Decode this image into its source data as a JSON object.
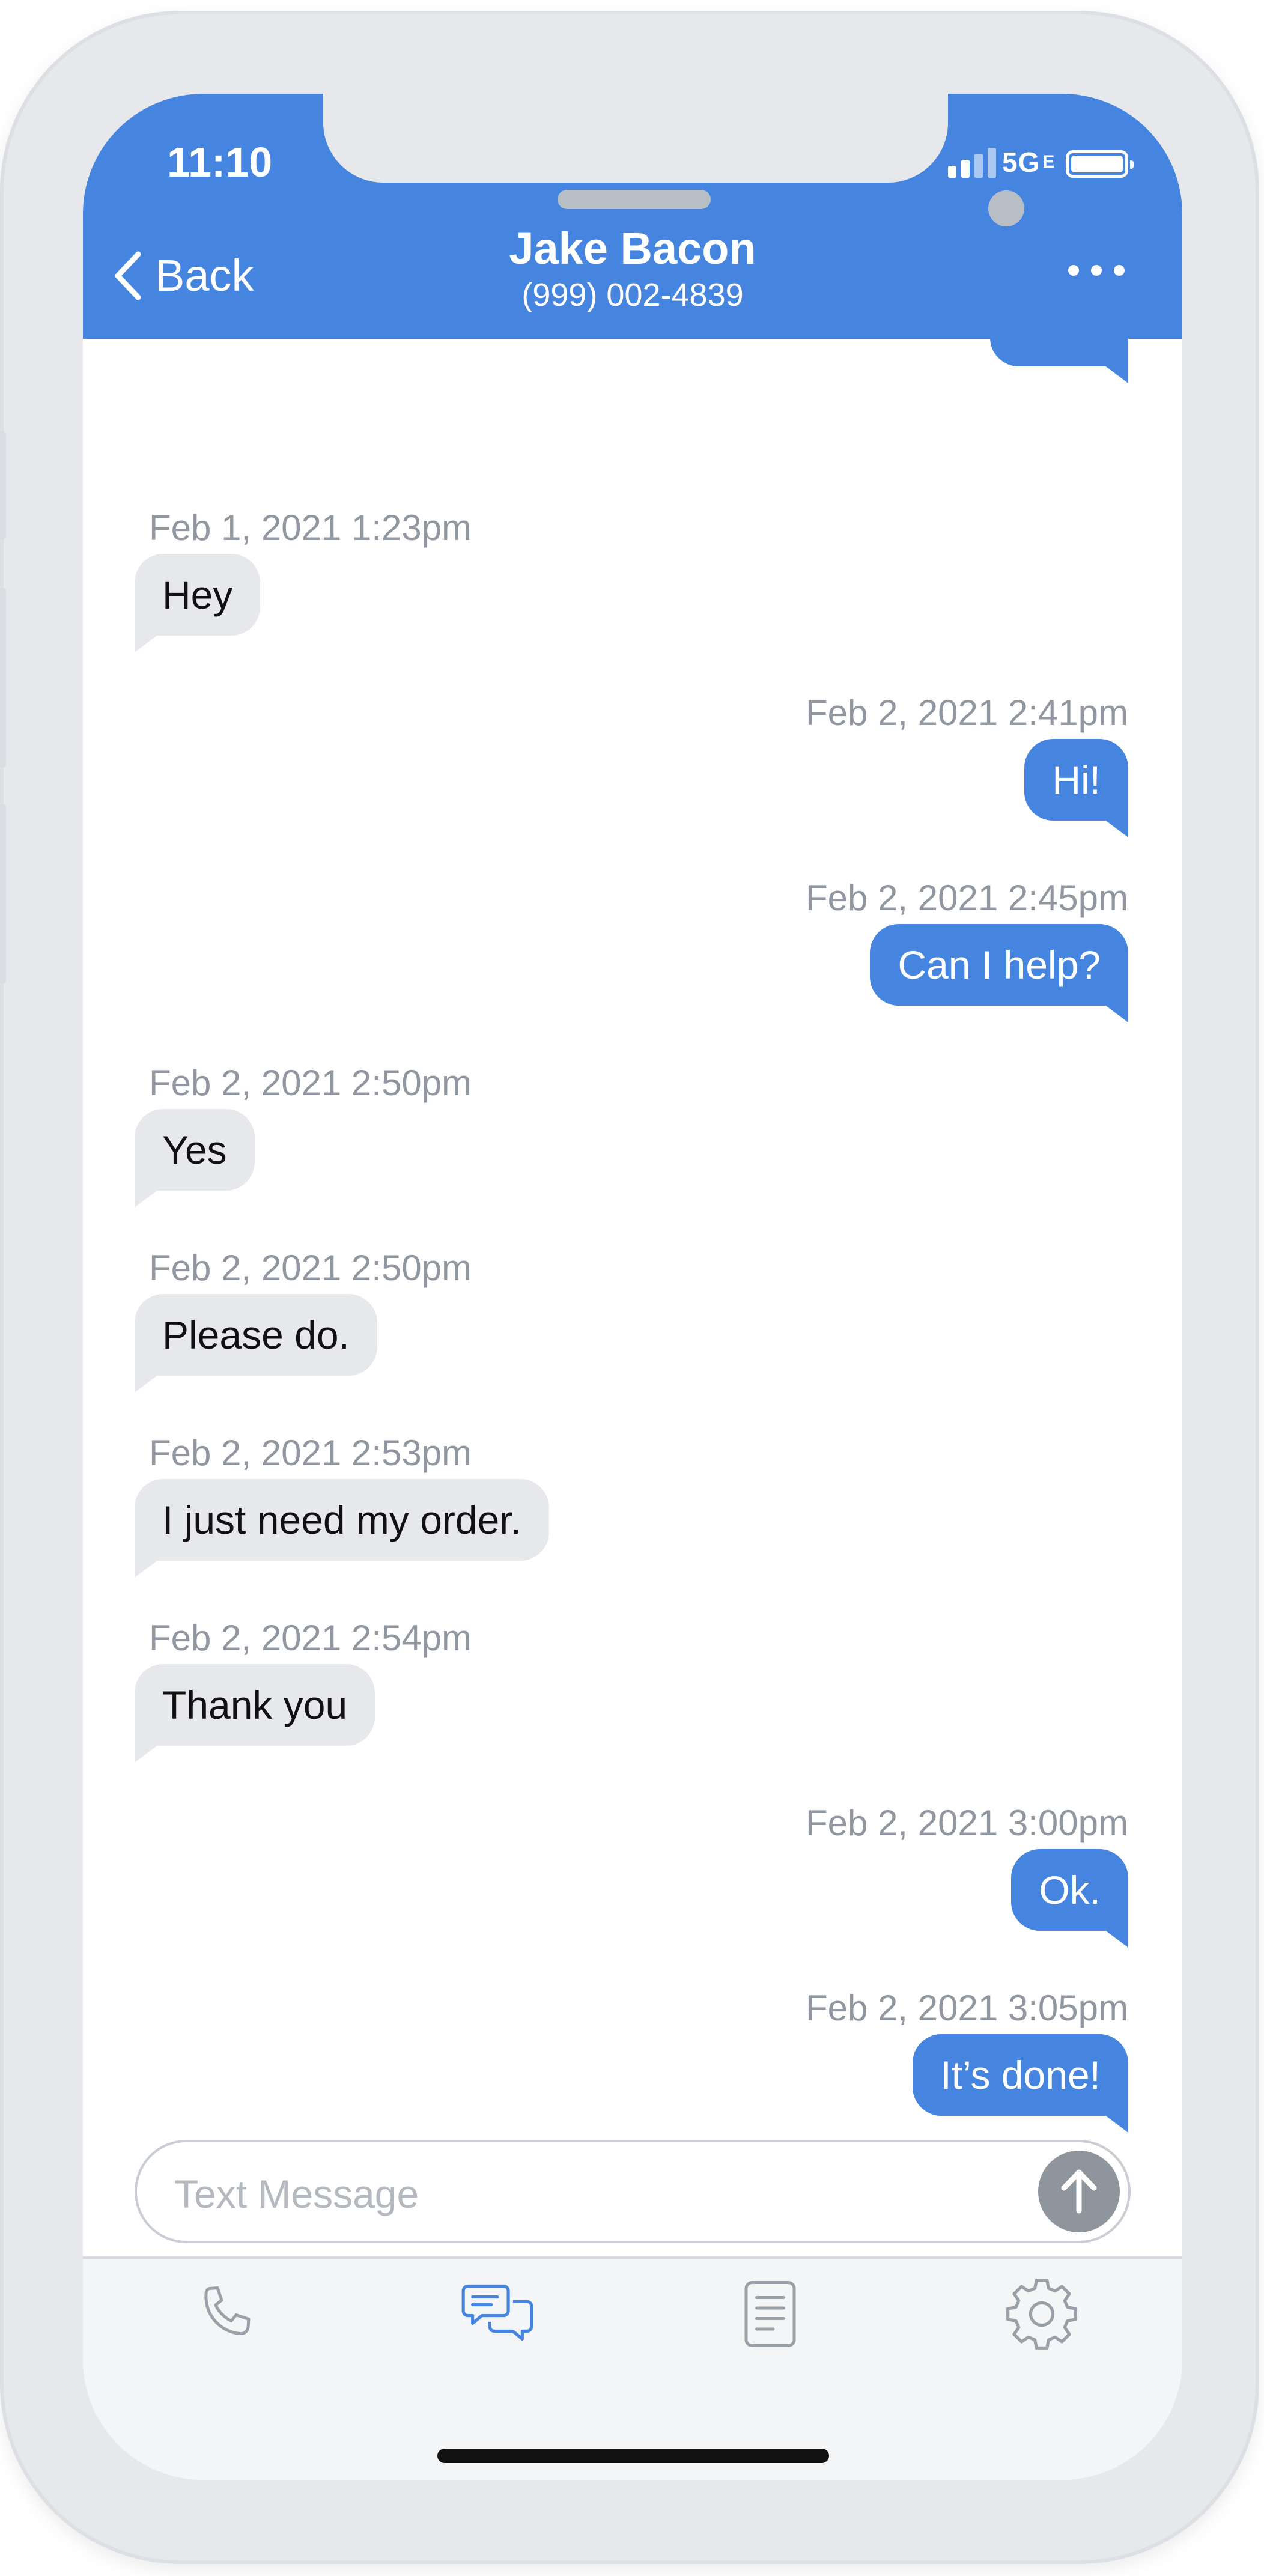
{
  "status_bar": {
    "time": "11:10",
    "network": "5G",
    "network_suffix": "E"
  },
  "header": {
    "back_label": "Back",
    "contact_name": "Jake Bacon",
    "contact_phone": "(999) 002-4839"
  },
  "messages": [
    {
      "direction": "in",
      "timestamp": "Feb 1, 2021 1:23pm",
      "text": "Hey"
    },
    {
      "direction": "out",
      "timestamp": "Feb 2, 2021 2:41pm",
      "text": "Hi!"
    },
    {
      "direction": "out",
      "timestamp": "Feb 2, 2021 2:45pm",
      "text": "Can I help?"
    },
    {
      "direction": "in",
      "timestamp": "Feb 2, 2021 2:50pm",
      "text": "Yes"
    },
    {
      "direction": "in",
      "timestamp": "Feb 2, 2021 2:50pm",
      "text": "Please do."
    },
    {
      "direction": "in",
      "timestamp": "Feb 2, 2021 2:53pm",
      "text": "I just need my order."
    },
    {
      "direction": "in",
      "timestamp": "Feb 2, 2021 2:54pm",
      "text": "Thank you"
    },
    {
      "direction": "out",
      "timestamp": "Feb 2, 2021 3:00pm",
      "text": "Ok."
    },
    {
      "direction": "out",
      "timestamp": "Feb 2, 2021 3:05pm",
      "text": "It’s done!"
    }
  ],
  "composer": {
    "placeholder": "Text Message",
    "value": ""
  },
  "tabs": [
    {
      "icon": "phone-icon",
      "active": false
    },
    {
      "icon": "messages-icon",
      "active": true
    },
    {
      "icon": "document-icon",
      "active": false
    },
    {
      "icon": "gear-icon",
      "active": false
    }
  ],
  "colors": {
    "accent": "#4585e0",
    "incoming_bubble": "#e6e8eb",
    "timestamp": "#9097a0",
    "inactive_icon": "#9aa0a7"
  }
}
